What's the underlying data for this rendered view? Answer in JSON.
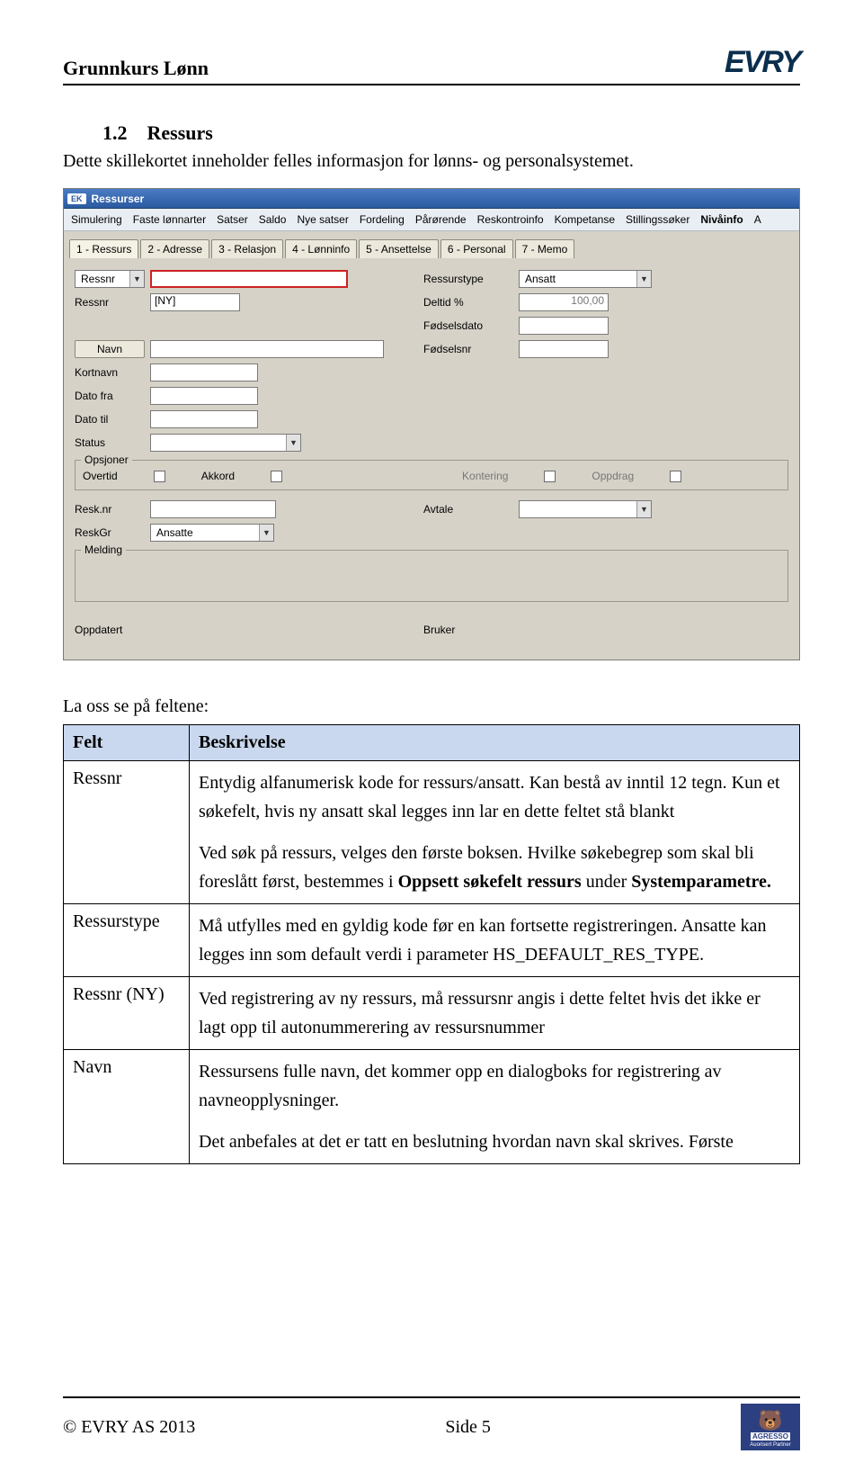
{
  "header": {
    "title": "Grunnkurs Lønn",
    "logo": "EVRY"
  },
  "section": {
    "num": "1.2",
    "title": "Ressurs"
  },
  "intro": "Dette skillekortet inneholder felles informasjon for lønns- og personalsystemet.",
  "app": {
    "windowTitle": "Ressurser",
    "ekBadge": "EK",
    "toolbar": [
      "Simulering",
      "Faste lønnarter",
      "Satser",
      "Saldo",
      "Nye satser",
      "Fordeling",
      "Pårørende",
      "Reskontroinfo",
      "Kompetanse",
      "Stillingssøker",
      "Nivåinfo",
      "A"
    ],
    "toolbarActiveIndex": 10,
    "tabs": [
      "1 - Ressurs",
      "2 - Adresse",
      "3 - Relasjon",
      "4 - Lønninfo",
      "5 - Ansettelse",
      "6 - Personal",
      "7 - Memo"
    ],
    "activeTab": 0,
    "labels": {
      "ressnrDd": "Ressnr",
      "ressurstype": "Ressurstype",
      "ressurstypeVal": "Ansatt",
      "ressnr2": "Ressnr",
      "ressnr2Val": "[NY]",
      "deltid": "Deltid %",
      "deltidVal": "100,00",
      "navn": "Navn",
      "fodselsdato": "Fødselsdato",
      "fodselsnr": "Fødselsnr",
      "kortnavn": "Kortnavn",
      "datofra": "Dato fra",
      "datotil": "Dato til",
      "status": "Status",
      "opsjoner": "Opsjoner",
      "overtid": "Overtid",
      "akkord": "Akkord",
      "kontering": "Kontering",
      "oppdrag": "Oppdrag",
      "resknr": "Resk.nr",
      "avtale": "Avtale",
      "reskgr": "ReskGr",
      "reskgrVal": "Ansatte",
      "melding": "Melding",
      "oppdatert": "Oppdatert",
      "bruker": "Bruker"
    }
  },
  "subhead": "La oss se på feltene:",
  "table": {
    "head": {
      "felt": "Felt",
      "besk": "Beskrivelse"
    },
    "rows": [
      {
        "felt": "Ressnr",
        "paras": [
          "Entydig alfanumerisk kode for ressurs/ansatt. Kan bestå av inntil 12 tegn. Kun et søkefelt, hvis ny ansatt skal legges inn lar en dette feltet stå blankt",
          "Ved søk på ressurs, velges den første boksen. Hvilke søkebegrep som skal bli foreslått først, bestemmes i <b>Oppsett søkefelt ressurs</b> under <b>Systemparametre.</b>"
        ]
      },
      {
        "felt": "Ressurstype",
        "paras": [
          "Må utfylles med en gyldig kode før en kan fortsette registreringen. Ansatte kan legges inn som default verdi i parameter HS_DEFAULT_RES_TYPE."
        ]
      },
      {
        "felt": "Ressnr (NY)",
        "paras": [
          "Ved registrering av ny ressurs, må ressursnr angis i dette feltet hvis det ikke er lagt opp til autonummerering av ressursnummer"
        ]
      },
      {
        "felt": "Navn",
        "paras": [
          "Ressursens fulle navn, det kommer opp en dialogboks for registrering av navneopplysninger.",
          "Det anbefales at det er tatt en beslutning hvordan navn skal skrives. Første"
        ]
      }
    ]
  },
  "footer": {
    "left": "© EVRY AS 2013",
    "right": "Side 5",
    "agresso": "AGRESSO",
    "agressoSub": "Auorisert Partner"
  }
}
